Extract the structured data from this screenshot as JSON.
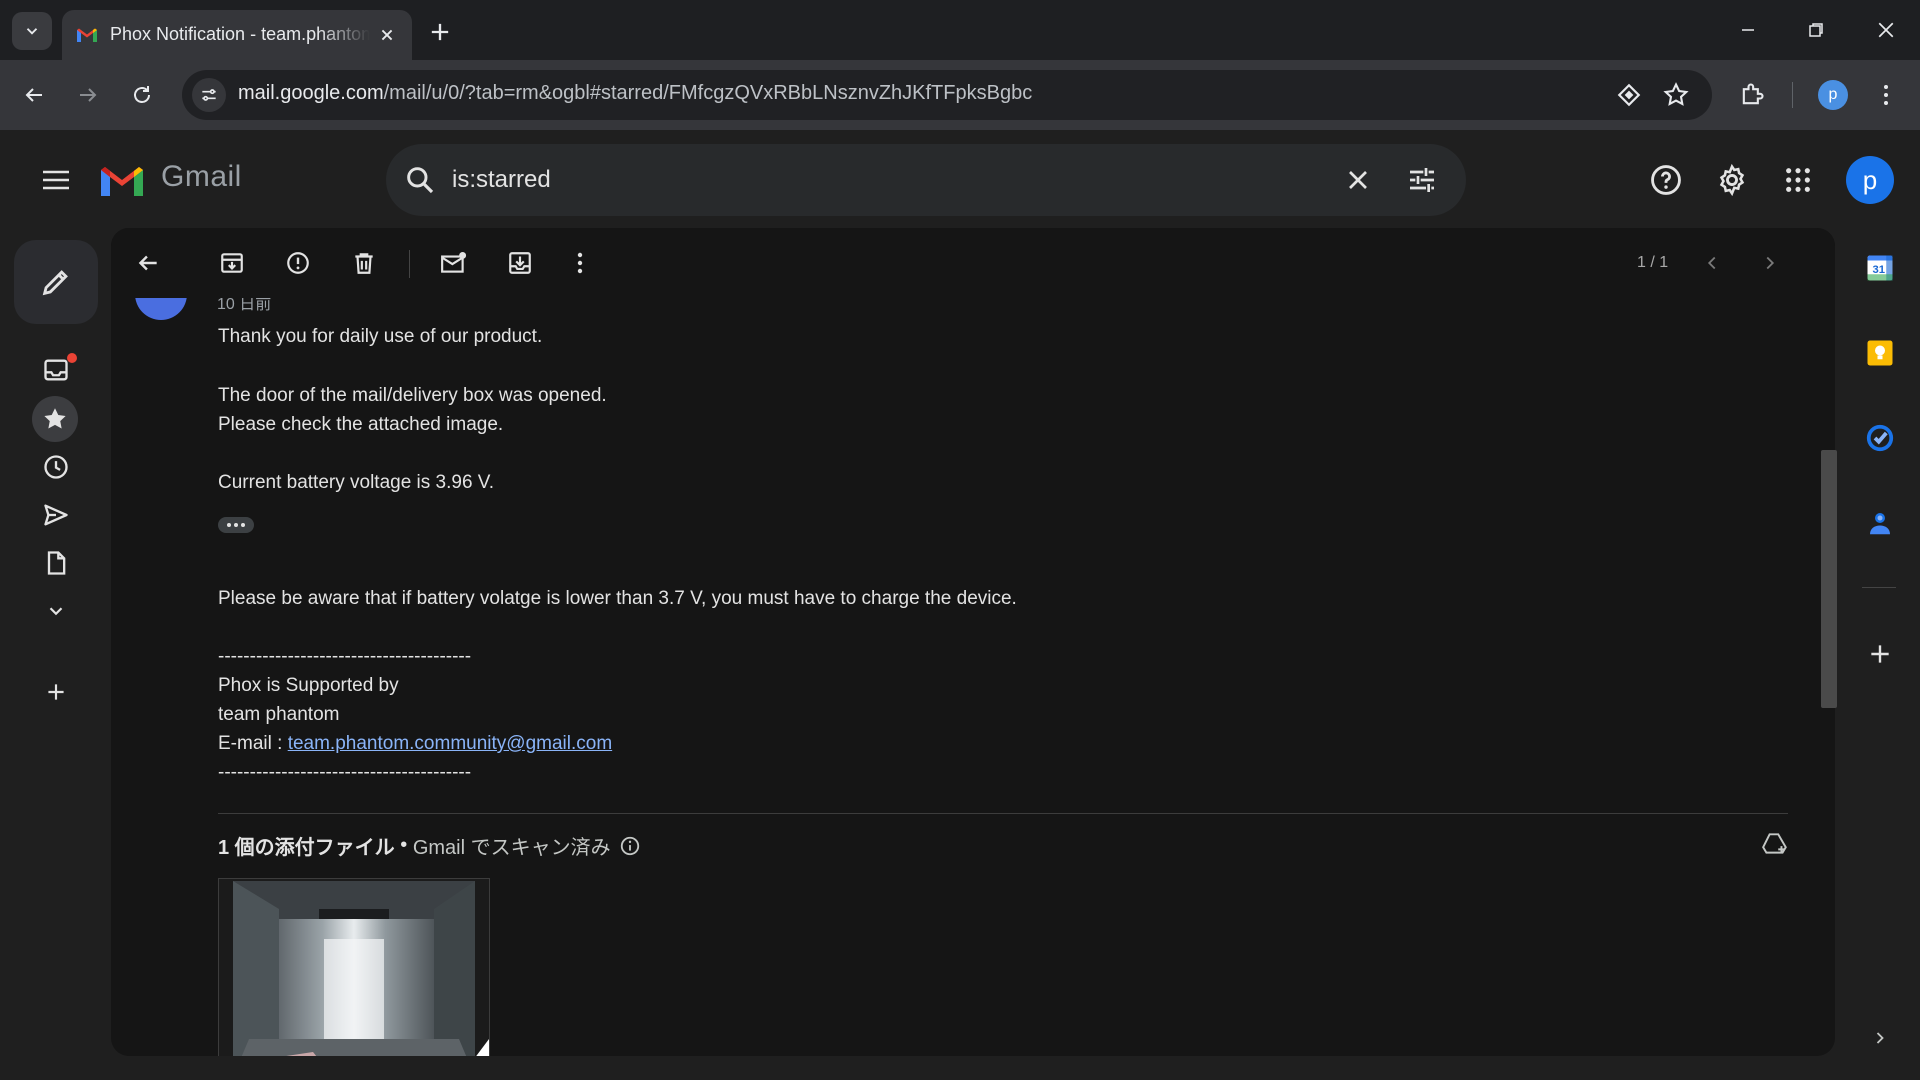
{
  "browser": {
    "tab": {
      "title": "Phox Notification - team.phantom.community@gmail.com - Gmail"
    },
    "url": {
      "host": "mail.google.com",
      "rest": "/mail/u/0/?tab=rm&ogbl#starred/FMfcgzQVxRBbLNsznvZhJKfTFpksBgbc"
    },
    "profile_initial": "p"
  },
  "gmail": {
    "wordmark": "Gmail",
    "search": {
      "value": "is:starred"
    },
    "account_initial": "p",
    "pager": "1 / 1"
  },
  "email": {
    "date_fragment": "10 日前",
    "lines": {
      "l1": "Thank you for daily use of our product.",
      "l2": "The door of the mail/delivery box was opened.",
      "l3": "Please check the attached image.",
      "l4": "Current battery voltage is 3.96 V.",
      "l5": "Please be aware that if battery volatge is lower than 3.7 V, you must have to charge the device.",
      "sep1": "----------------------------------------",
      "l6": "Phox is Supported by",
      "l7": "team phantom",
      "email_label": "E-mail : ",
      "email_link": "team.phantom.community@gmail.com",
      "sep2": "----------------------------------------"
    },
    "attachments": {
      "count_label": "1 個の添付ファイル",
      "dot": " • ",
      "scan_label": "Gmail でスキャン済み"
    }
  },
  "colors": {
    "accent_blue": "#8ab4f8",
    "avatar_blue": "#1a73e8",
    "unread_dot": "#ea4335",
    "keep_yellow": "#fbbc04"
  }
}
